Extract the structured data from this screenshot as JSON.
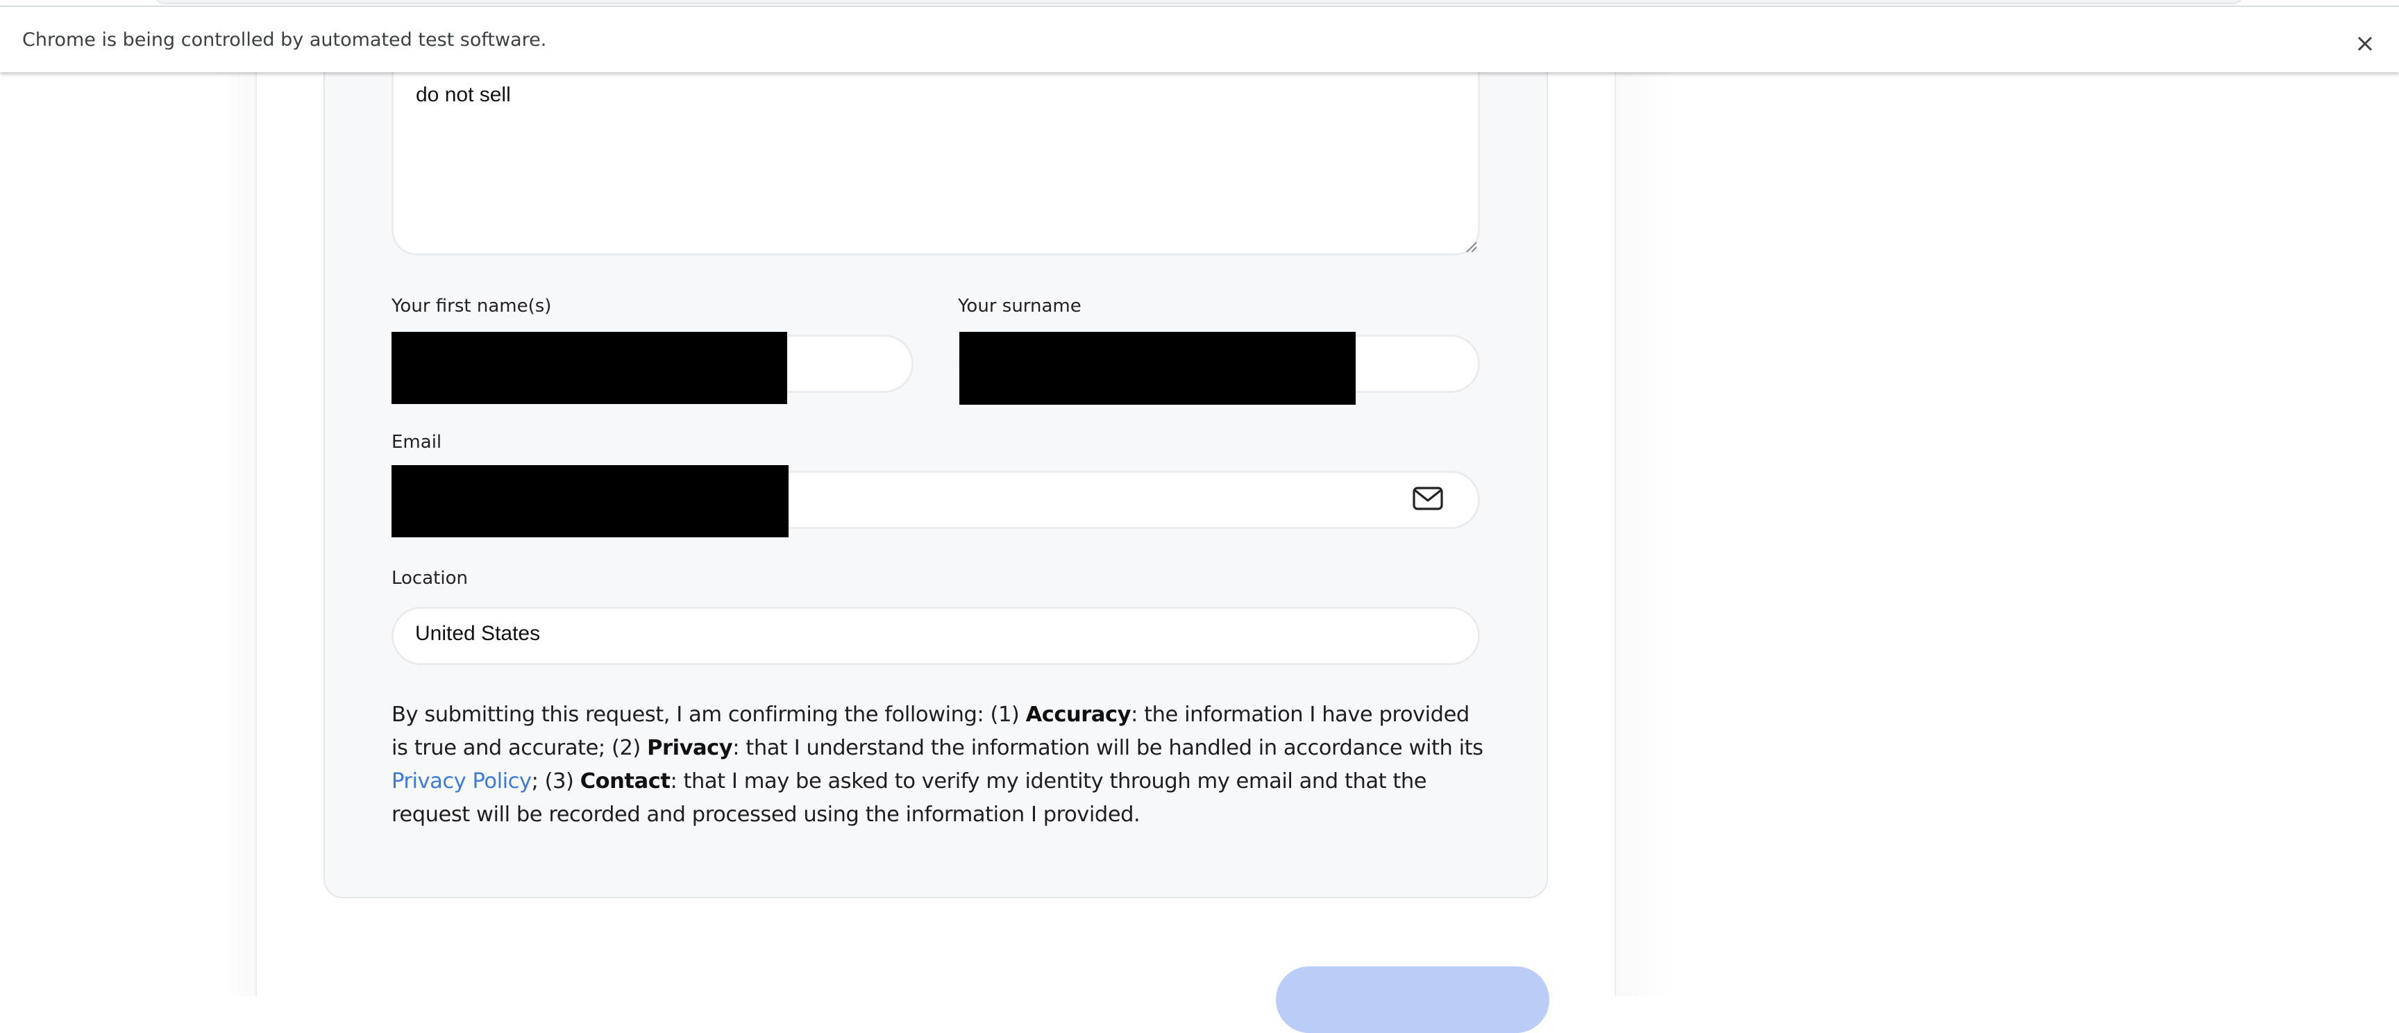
{
  "infobar": {
    "message": "Chrome is being controlled by automated test software.",
    "close_icon": "close-icon"
  },
  "form": {
    "message": {
      "value": "do not sell"
    },
    "first_name": {
      "label": "Your first name(s)",
      "value_redacted": true
    },
    "surname": {
      "label": "Your surname",
      "value_redacted": true
    },
    "email": {
      "label": "Email",
      "value_redacted": true,
      "icon": "mail-icon"
    },
    "location": {
      "label": "Location",
      "value": "United States"
    },
    "consent": {
      "intro": "By submitting this request, I am confirming the following: (1) ",
      "accuracy_title": "Accuracy",
      "accuracy_text": ": the information I have provided is true and accurate; (2) ",
      "privacy_title": "Privacy",
      "privacy_text": ": that I understand the information will be handled in accordance with its ",
      "privacy_link": "Privacy Policy",
      "privacy_after": "; (3) ",
      "contact_title": "Contact",
      "contact_text": ": that I may be asked to verify my identity through my email and that the request will be recorded and processed using the information I provided."
    }
  },
  "colors": {
    "link": "#3d7bd9",
    "submit_button": "#b9cdf7",
    "card_background": "#f7f8fa"
  }
}
